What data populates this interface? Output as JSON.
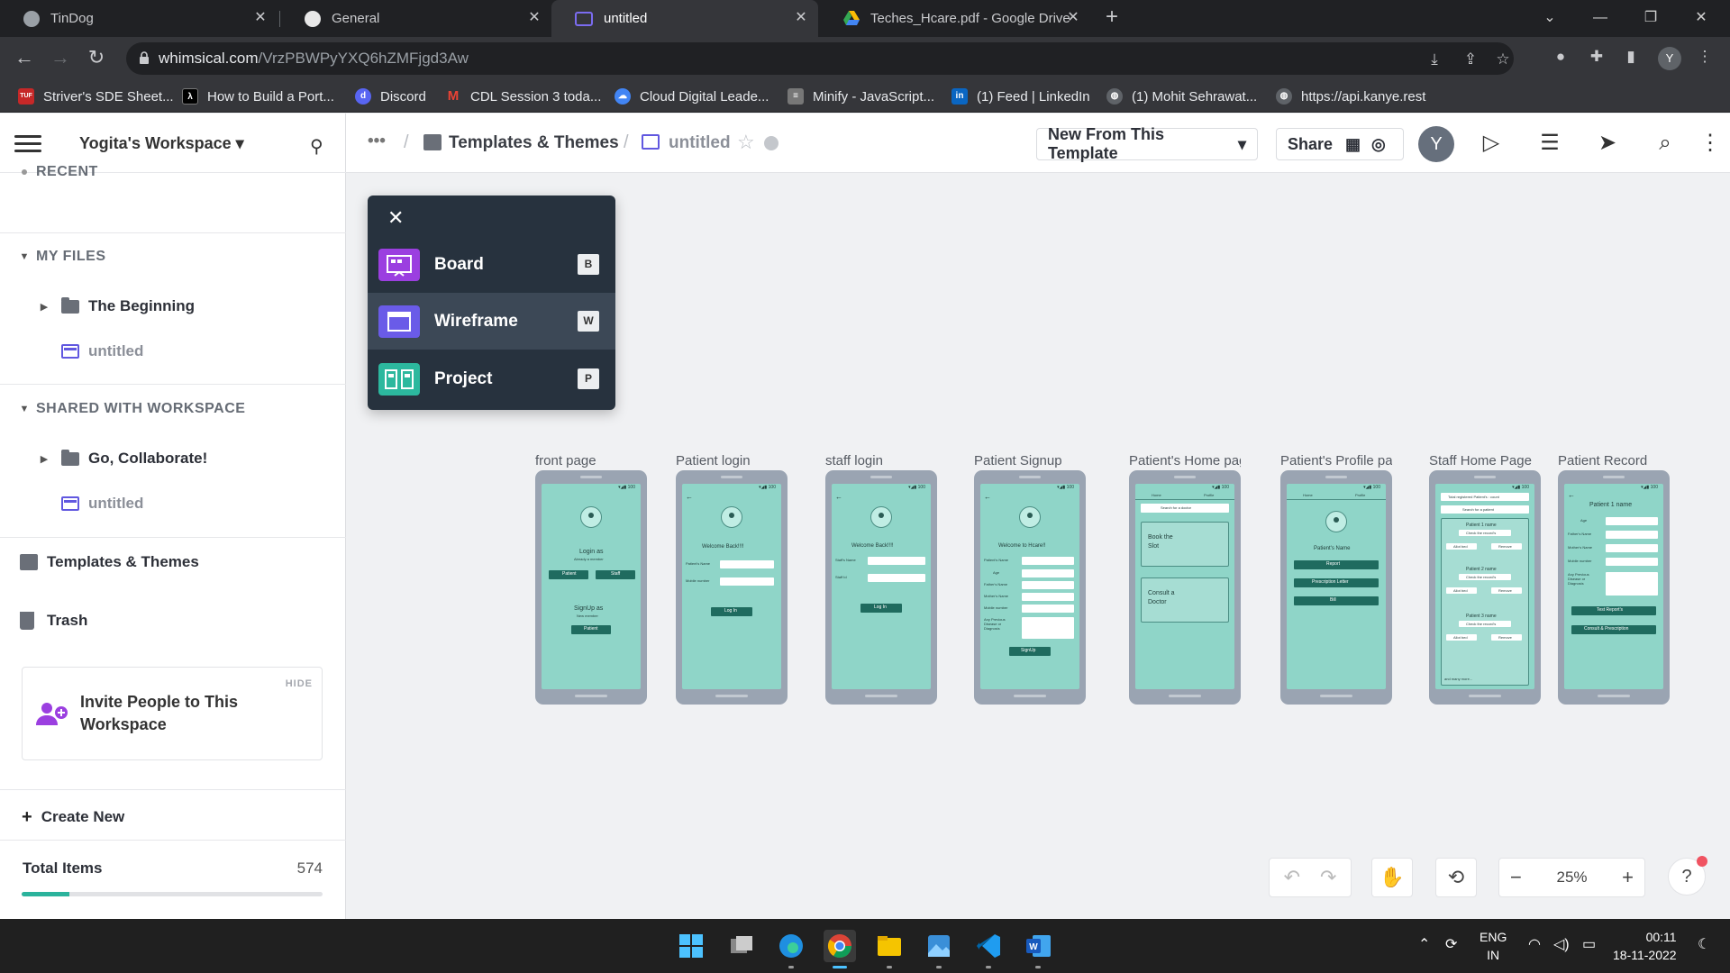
{
  "browser": {
    "tabs": [
      {
        "title": "TinDog",
        "icon": "tindog-favicon",
        "active": false
      },
      {
        "title": "General",
        "icon": "github-icon",
        "active": false
      },
      {
        "title": "untitled",
        "icon": "whimsical-wireframe-icon",
        "active": true
      },
      {
        "title": "Teches_Hcare.pdf - Google Drive",
        "icon": "google-drive-icon",
        "active": false
      }
    ],
    "url_domain": "whimsical.com",
    "url_path": "/VrzPBWPyYXQ6hZMFjgd3Aw",
    "profile_initial": "Y",
    "bookmarks": [
      {
        "label": "Striver's SDE Sheet...",
        "icon": "tuf-icon"
      },
      {
        "label": "How to Build a Port...",
        "icon": "lambda-icon"
      },
      {
        "label": "Discord",
        "icon": "discord-icon"
      },
      {
        "label": "CDL Session 3 toda...",
        "icon": "gmail-icon"
      },
      {
        "label": "Cloud Digital Leade...",
        "icon": "google-cloud-icon"
      },
      {
        "label": "Minify - JavaScript...",
        "icon": "minify-icon"
      },
      {
        "label": "(1) Feed | LinkedIn",
        "icon": "linkedin-icon"
      },
      {
        "label": "(1) Mohit Sehrawat...",
        "icon": "globe-icon"
      },
      {
        "label": "https://api.kanye.rest",
        "icon": "globe-icon"
      }
    ]
  },
  "sidebar": {
    "workspace": "Yogita's Workspace",
    "recent": "RECENT",
    "my_files": "MY FILES",
    "my_files_items": [
      {
        "label": "The Beginning",
        "type": "folder"
      },
      {
        "label": "untitled",
        "type": "wireframe"
      }
    ],
    "shared": "SHARED WITH WORKSPACE",
    "shared_items": [
      {
        "label": "Go, Collaborate!",
        "type": "folder"
      },
      {
        "label": "untitled",
        "type": "wireframe"
      }
    ],
    "templates": "Templates & Themes",
    "trash": "Trash",
    "invite": {
      "hide": "HIDE",
      "text": "Invite People to This Workspace"
    },
    "create_new": "Create New",
    "total_items_label": "Total Items",
    "total_items_value": "574",
    "usage_fraction": 0.16
  },
  "topbar": {
    "more": "•••",
    "breadcrumb_parent": "Templates & Themes",
    "breadcrumb_current": "untitled",
    "new_from_template": "New From This Template",
    "share": "Share",
    "avatar_initial": "Y"
  },
  "popup": {
    "items": [
      {
        "label": "Board",
        "key": "B",
        "color": "#9b3fe0"
      },
      {
        "label": "Wireframe",
        "key": "W",
        "color": "#6a5be8"
      },
      {
        "label": "Project",
        "key": "P",
        "color": "#2cb89e"
      }
    ]
  },
  "wireframes": [
    {
      "label": "front page"
    },
    {
      "label": "Patient login"
    },
    {
      "label": "staff login"
    },
    {
      "label": "Patient Signup"
    },
    {
      "label": "Patient's Home page"
    },
    {
      "label": "Patient's Profile page"
    },
    {
      "label": "Staff Home Page"
    },
    {
      "label": "Patient Record"
    }
  ],
  "screens": {
    "front": {
      "login_as": "Login as",
      "already": "Already a member",
      "patient": "Patient",
      "staff": "Staff",
      "signup_as": "SignUp as",
      "new_member": "New member",
      "patient2": "Patient"
    },
    "plogin": {
      "welcome": "Welcome Back!!!!",
      "name": "Patient's Name",
      "mobile": "Mobile number",
      "btn": "Log In"
    },
    "slogin": {
      "welcome": "Welcome Back!!!!",
      "name": "Staff's Name",
      "id": "Staff Id",
      "btn": "Log In"
    },
    "signup": {
      "welcome": "Welcome to Hcare!!",
      "f1": "Patient's Name",
      "f2": "Age",
      "f3": "Father's Name",
      "f4": "Mother's Name",
      "f5": "Mobile number",
      "f6": "Any Previous Disease or Diagnosis",
      "btn": "SignUp"
    },
    "phome": {
      "tab1": "Home",
      "tab2": "Profile",
      "search": "Search for a doctor",
      "book": "Book the Slot",
      "consult": "Consult a Doctor"
    },
    "pprofile": {
      "tab1": "Home",
      "tab2": "Profile",
      "name": "Patient's Name",
      "b1": "Report",
      "b2": "Prescription Letter",
      "b3": "Bill"
    },
    "shome": {
      "count": "Total registered Patient's : count",
      "search": "Search for a patient",
      "p1": "Patient 1 name",
      "p2": "Patient 2 name",
      "p3": "Patient 3 name",
      "check": "Check the record's",
      "allot": "Allot bed",
      "remove": "Remove",
      "more": "and many more..."
    },
    "precord": {
      "title": "Patient 1 name",
      "age": "Age",
      "father": "Father's Name",
      "mother": "Mother's Name",
      "mobile": "Mobile number",
      "disease": "Any Previous Disease or Diagnosis",
      "b1": "Test Report's",
      "b2": "Consult & Prescription"
    }
  },
  "controls": {
    "zoom": "25%",
    "help": "?"
  },
  "taskbar": {
    "lang1": "ENG",
    "lang2": "IN",
    "time": "00:11",
    "date": "18-11-2022"
  }
}
